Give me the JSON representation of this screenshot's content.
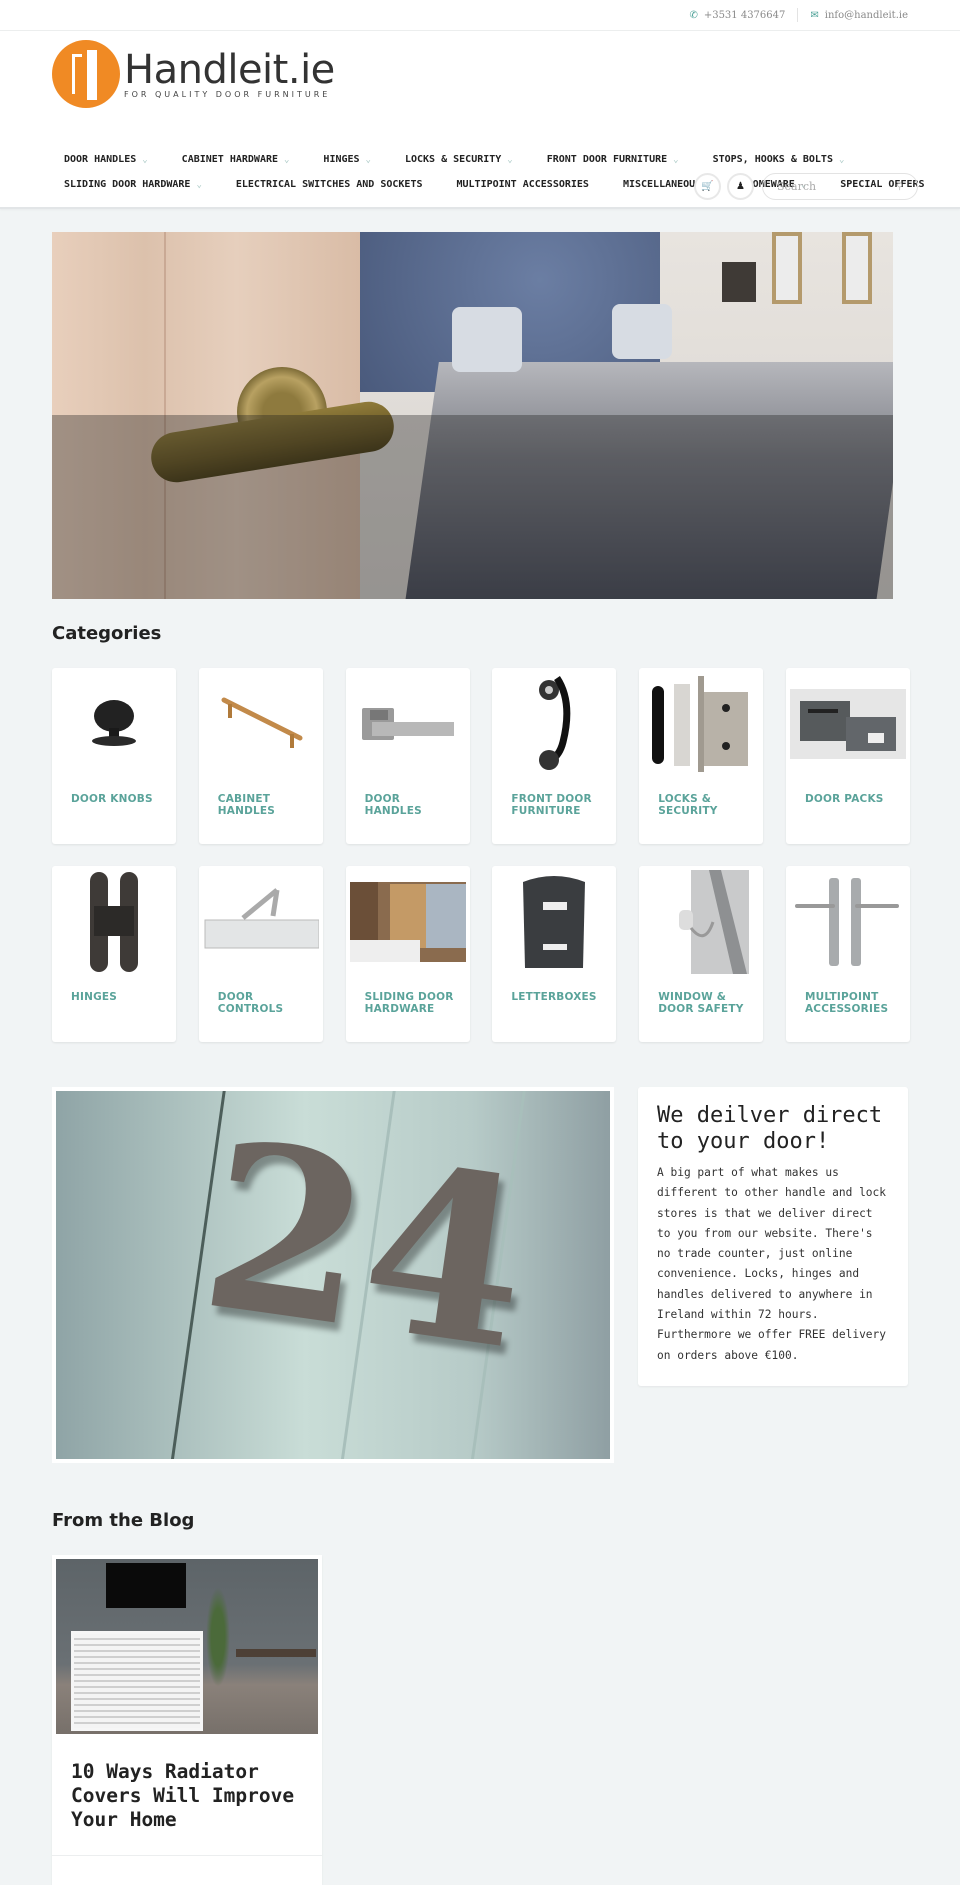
{
  "topbar": {
    "phone_icon": "phone-icon",
    "phone": "+3531 4376647",
    "email_icon": "envelope-icon",
    "email": "info@handleit.ie"
  },
  "brand": {
    "name": "Handleit.ie",
    "tagline": "FOR QUALITY DOOR FURNITURE",
    "accent_color": "#f08a24"
  },
  "nav": {
    "row1": [
      {
        "label": "DOOR HANDLES",
        "has_dropdown": true
      },
      {
        "label": "CABINET HARDWARE",
        "has_dropdown": true
      },
      {
        "label": "HINGES",
        "has_dropdown": true
      },
      {
        "label": "LOCKS & SECURITY",
        "has_dropdown": true
      },
      {
        "label": "FRONT DOOR FURNITURE",
        "has_dropdown": true
      },
      {
        "label": "STOPS, HOOKS & BOLTS",
        "has_dropdown": true
      }
    ],
    "row2": [
      {
        "label": "SLIDING DOOR HARDWARE",
        "has_dropdown": true
      },
      {
        "label": "ELECTRICAL SWITCHES AND SOCKETS",
        "has_dropdown": false
      },
      {
        "label": "MULTIPOINT ACCESSORIES",
        "has_dropdown": false
      },
      {
        "label": "MISCELLANEOUS",
        "has_dropdown": true
      },
      {
        "label": "HOMEWARE",
        "has_dropdown": true
      },
      {
        "label": "SPECIAL OFFERS",
        "has_dropdown": false
      }
    ],
    "chevron": "⌄"
  },
  "tools": {
    "cart_icon": "cart-icon",
    "account_icon": "user-icon",
    "search_placeholder": "Search",
    "search_icon": "search-icon"
  },
  "categories": {
    "title": "Categories",
    "link_color": "#5aa39a",
    "items": [
      {
        "label": "DOOR KNOBS"
      },
      {
        "label": "CABINET HANDLES"
      },
      {
        "label": "DOOR HANDLES"
      },
      {
        "label": "FRONT DOOR FURNITURE"
      },
      {
        "label": "LOCKS & SECURITY"
      },
      {
        "label": "DOOR PACKS"
      },
      {
        "label": "HINGES"
      },
      {
        "label": "DOOR CONTROLS"
      },
      {
        "label": "SLIDING DOOR HARDWARE"
      },
      {
        "label": "LETTERBOXES"
      },
      {
        "label": "WINDOW & DOOR SAFETY"
      },
      {
        "label": "MULTIPOINT ACCESSORIES"
      }
    ]
  },
  "delivery": {
    "image_digits": "24",
    "title": "We deilver direct to your door!",
    "body": "A big part of what makes us different to other handle and lock stores is that we deliver direct to you from our website. There's no trade counter, just online convenience. Locks, hinges and handles delivered to anywhere in Ireland within 72 hours. Furthermore we offer FREE delivery on orders above €100."
  },
  "blog": {
    "title": "From the Blog",
    "posts": [
      {
        "title": "10 Ways Radiator Covers Will Improve Your Home"
      }
    ]
  }
}
